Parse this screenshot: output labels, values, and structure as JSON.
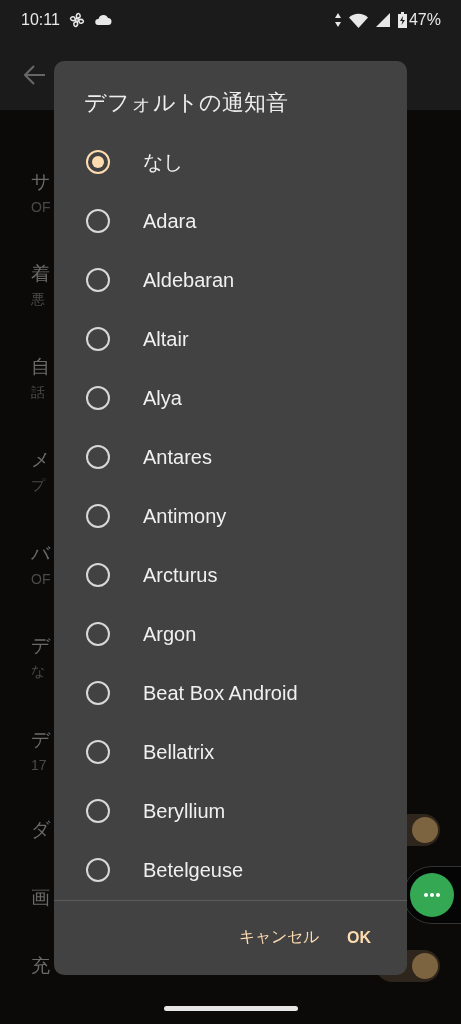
{
  "status_bar": {
    "time": "10:11",
    "battery": "47%"
  },
  "settings": [
    {
      "kind": "text",
      "title": "サ",
      "subtitle": "OF"
    },
    {
      "kind": "text",
      "title": "着",
      "subtitle": "悪"
    },
    {
      "kind": "text",
      "title": "自",
      "subtitle": "話"
    },
    {
      "kind": "text",
      "title": "メ",
      "subtitle": "プ"
    },
    {
      "kind": "text",
      "title": "バ",
      "subtitle": "OF"
    },
    {
      "kind": "text",
      "title": "デ",
      "subtitle": "な"
    },
    {
      "kind": "text",
      "title": "デ",
      "subtitle": "17"
    },
    {
      "kind": "toggle",
      "title": "ダ",
      "on": true
    },
    {
      "kind": "text",
      "title": "画"
    },
    {
      "kind": "toggle",
      "title": "充",
      "on": true
    }
  ],
  "dialog": {
    "title": "デフォルトの通知音",
    "options": [
      {
        "label": "なし",
        "selected": true
      },
      {
        "label": "Adara",
        "selected": false
      },
      {
        "label": "Aldebaran",
        "selected": false
      },
      {
        "label": "Altair",
        "selected": false
      },
      {
        "label": "Alya",
        "selected": false
      },
      {
        "label": "Antares",
        "selected": false
      },
      {
        "label": "Antimony",
        "selected": false
      },
      {
        "label": "Arcturus",
        "selected": false
      },
      {
        "label": "Argon",
        "selected": false
      },
      {
        "label": "Beat Box Android",
        "selected": false
      },
      {
        "label": "Bellatrix",
        "selected": false
      },
      {
        "label": "Beryllium",
        "selected": false
      },
      {
        "label": "Betelgeuse",
        "selected": false
      }
    ],
    "buttons": [
      {
        "label": "キャンセル"
      },
      {
        "label": "OK"
      }
    ]
  }
}
